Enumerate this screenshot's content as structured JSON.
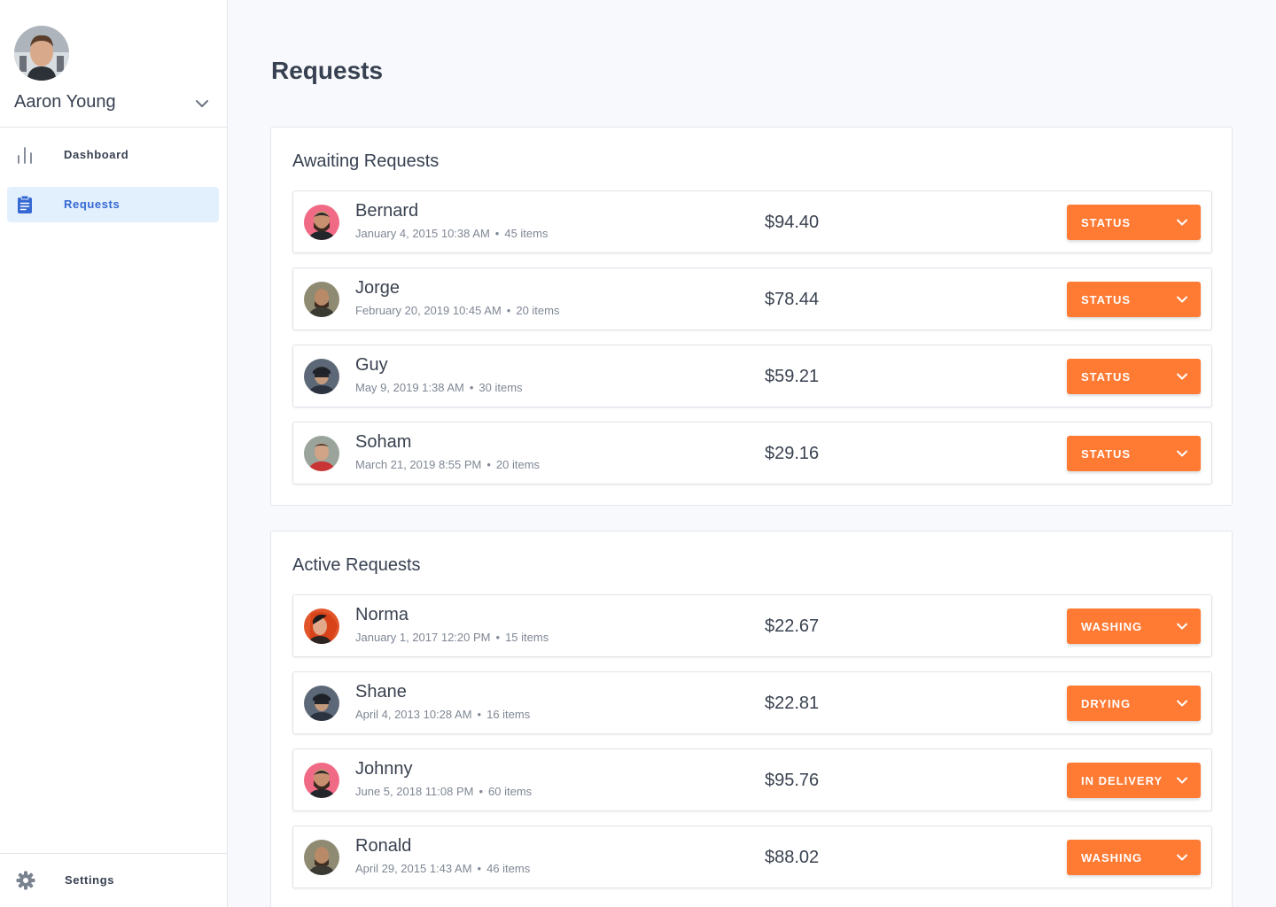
{
  "user": {
    "name": "Aaron Young"
  },
  "nav": {
    "dashboard": "Dashboard",
    "requests": "Requests",
    "settings": "Settings"
  },
  "page": {
    "title": "Requests"
  },
  "colors": {
    "accent": "#ff7a33",
    "active_nav_bg": "#e2effd",
    "active_nav_text": "#3568d4"
  },
  "awaiting": {
    "title": "Awaiting Requests",
    "rows": [
      {
        "name": "Bernard",
        "date": "January 4, 2015 10:38 AM",
        "items": "45 items",
        "price": "$94.40",
        "status": "STATUS"
      },
      {
        "name": "Jorge",
        "date": "February 20, 2019 10:45 AM",
        "items": "20 items",
        "price": "$78.44",
        "status": "STATUS"
      },
      {
        "name": "Guy",
        "date": "May 9, 2019 1:38 AM",
        "items": "30 items",
        "price": "$59.21",
        "status": "STATUS"
      },
      {
        "name": "Soham",
        "date": "March 21, 2019 8:55 PM",
        "items": "20 items",
        "price": "$29.16",
        "status": "STATUS"
      }
    ]
  },
  "active": {
    "title": "Active Requests",
    "rows": [
      {
        "name": "Norma",
        "date": "January 1, 2017 12:20 PM",
        "items": "15 items",
        "price": "$22.67",
        "status": "WASHING"
      },
      {
        "name": "Shane",
        "date": "April 4, 2013 10:28 AM",
        "items": "16 items",
        "price": "$22.81",
        "status": "DRYING"
      },
      {
        "name": "Johnny",
        "date": "June 5, 2018 11:08 PM",
        "items": "60 items",
        "price": "$95.76",
        "status": "IN DELIVERY"
      },
      {
        "name": "Ronald",
        "date": "April 29, 2015 1:43 AM",
        "items": "46 items",
        "price": "$88.02",
        "status": "WASHING"
      }
    ]
  }
}
